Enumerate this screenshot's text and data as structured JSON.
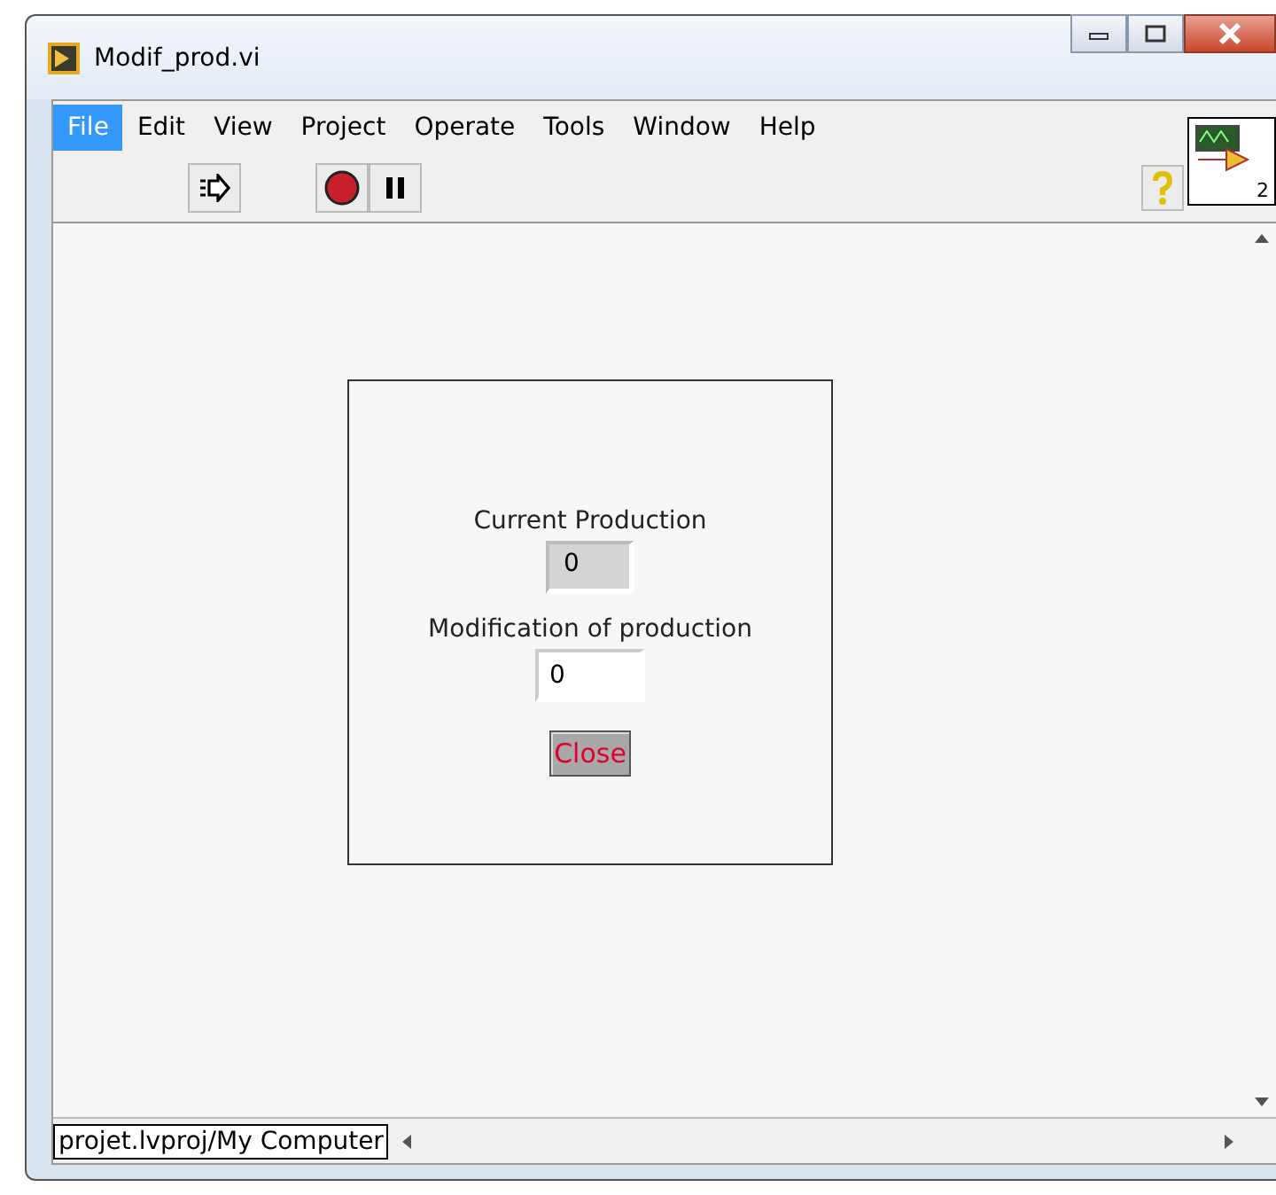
{
  "window": {
    "title": "Modif_prod.vi"
  },
  "menu": [
    {
      "label": "File",
      "selected": true
    },
    {
      "label": "Edit",
      "selected": false
    },
    {
      "label": "View",
      "selected": false
    },
    {
      "label": "Project",
      "selected": false
    },
    {
      "label": "Operate",
      "selected": false
    },
    {
      "label": "Tools",
      "selected": false
    },
    {
      "label": "Window",
      "selected": false
    },
    {
      "label": "Help",
      "selected": false
    }
  ],
  "vi_icon": {
    "label": "2"
  },
  "panel": {
    "controls": [
      {
        "kind": "indicator",
        "label": "Current Production",
        "value": "0"
      },
      {
        "kind": "control",
        "label": "Modification of production",
        "value": "0"
      },
      {
        "kind": "button",
        "label": "Close"
      }
    ]
  },
  "status_bar": {
    "target": "projet.lvproj/My Computer"
  }
}
